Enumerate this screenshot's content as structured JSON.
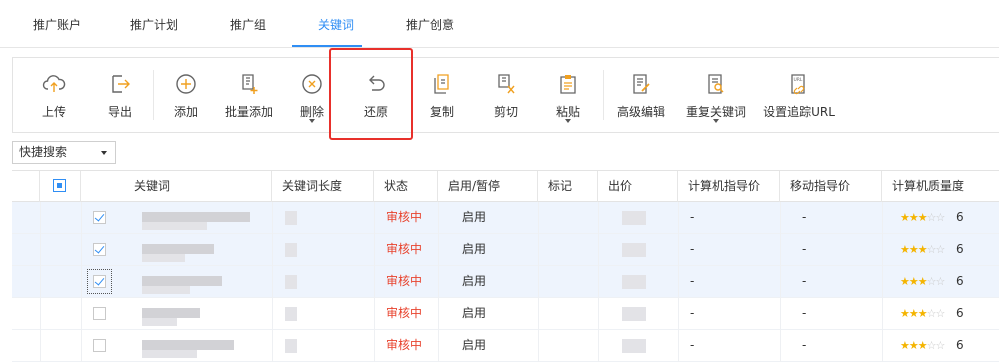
{
  "tabs": [
    {
      "label": "推广账户",
      "active": false
    },
    {
      "label": "推广计划",
      "active": false
    },
    {
      "label": "推广组",
      "active": false
    },
    {
      "label": "关键词",
      "active": true
    },
    {
      "label": "推广创意",
      "active": false
    }
  ],
  "toolbar": {
    "buttons": [
      {
        "label": "上传",
        "icon": "cloud-upload-icon",
        "dropdown": false
      },
      {
        "label": "导出",
        "icon": "export-icon",
        "dropdown": false
      },
      {
        "label": "添加",
        "icon": "add-circle-icon",
        "dropdown": false
      },
      {
        "label": "批量添加",
        "icon": "batch-add-icon",
        "dropdown": false
      },
      {
        "label": "删除",
        "icon": "delete-circle-icon",
        "dropdown": true
      },
      {
        "label": "还原",
        "icon": "undo-icon",
        "dropdown": false,
        "highlighted": true
      },
      {
        "label": "复制",
        "icon": "copy-icon",
        "dropdown": false
      },
      {
        "label": "剪切",
        "icon": "cut-icon",
        "dropdown": false
      },
      {
        "label": "粘贴",
        "icon": "paste-icon",
        "dropdown": true
      },
      {
        "label": "高级编辑",
        "icon": "advanced-edit-icon",
        "dropdown": false
      },
      {
        "label": "重复关键词",
        "icon": "duplicate-search-icon",
        "dropdown": true
      },
      {
        "label": "设置追踪URL",
        "icon": "tracking-url-icon",
        "dropdown": false
      }
    ],
    "highlight_color": "#e8302b"
  },
  "quick_search": {
    "label": "快捷搜索"
  },
  "table": {
    "headers": [
      "关键词",
      "关键词长度",
      "状态",
      "启用/暂停",
      "标记",
      "出价",
      "计算机指导价",
      "移动指导价",
      "计算机质量度"
    ],
    "rows": [
      {
        "checked": true,
        "focused": false,
        "status": "审核中",
        "enable": "启用",
        "pc_guide": "-",
        "mobile_guide": "-",
        "quality_stars": 3,
        "quality": "6"
      },
      {
        "checked": true,
        "focused": false,
        "status": "审核中",
        "enable": "启用",
        "pc_guide": "-",
        "mobile_guide": "-",
        "quality_stars": 3,
        "quality": "6"
      },
      {
        "checked": true,
        "focused": true,
        "status": "审核中",
        "enable": "启用",
        "pc_guide": "-",
        "mobile_guide": "-",
        "quality_stars": 3,
        "quality": "6"
      },
      {
        "checked": false,
        "focused": false,
        "status": "审核中",
        "enable": "启用",
        "pc_guide": "-",
        "mobile_guide": "-",
        "quality_stars": 3,
        "quality": "6"
      },
      {
        "checked": false,
        "focused": false,
        "status": "审核中",
        "enable": "启用",
        "pc_guide": "-",
        "mobile_guide": "-",
        "quality_stars": 3,
        "quality": "6"
      }
    ]
  },
  "colors": {
    "accent": "#2f8ef4",
    "status_red": "#e8432e",
    "star": "#f4b400",
    "selected_row": "#eef4fd"
  }
}
